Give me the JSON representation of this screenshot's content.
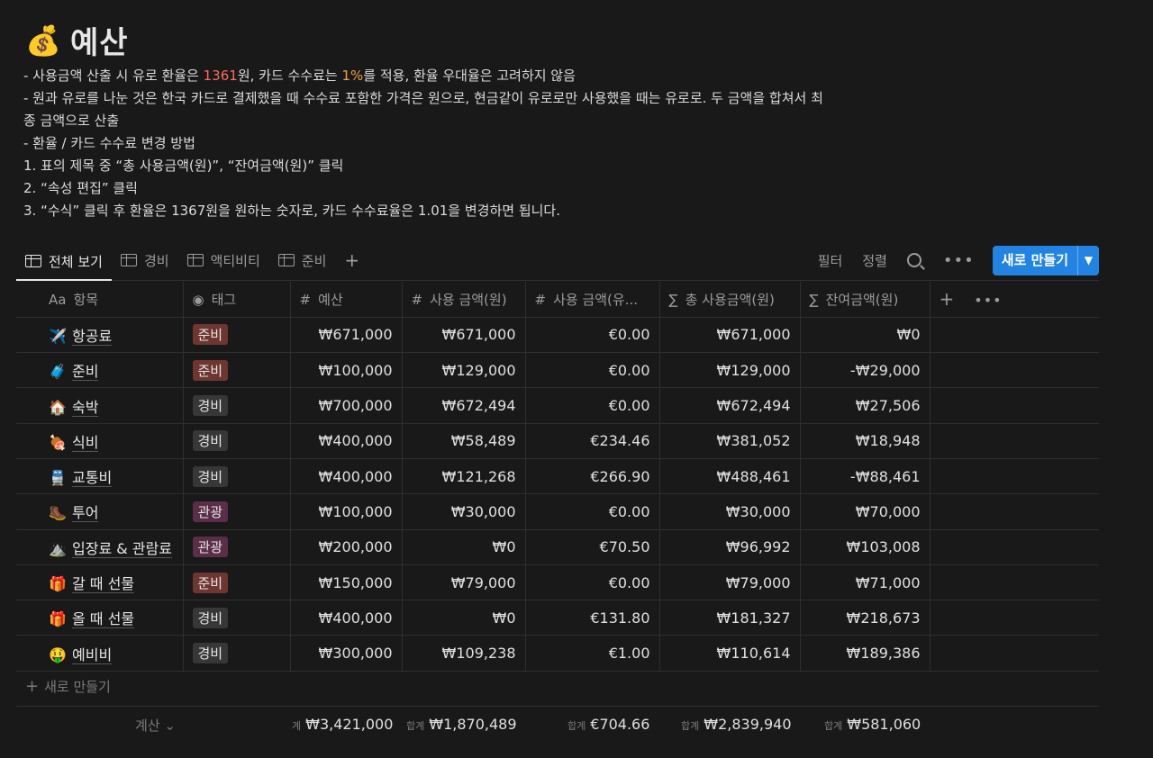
{
  "page": {
    "icon": "money-bag-icon",
    "title": "예산"
  },
  "description": {
    "line1_a": "- 사용금액 산출 시 유로 환율은 ",
    "line1_rate": "1361",
    "line1_b": "원, 카드 수수료는 ",
    "line1_fee": "1%",
    "line1_c": "를 적용, 환율 우대율은 고려하지 않음",
    "line2": "- 원과 유로를 나눈 것은 한국 카드로 결제했을 때 수수료 포함한 가격은 원으로, 현금같이 유로로만 사용했을 때는 유로로. 두 금액을 합쳐서 최",
    "line3": "종 금액으로 산출",
    "line4": "- 환율 / 카드 수수료 변경 방법",
    "line5": "1. 표의 제목 중 “총 사용금액(원)”, “잔여금액(원)” 클릭",
    "line6": "2. “속성 편집” 클릭",
    "line7": "3. “수식” 클릭 후 환율은 1367원을 원하는 숫자로, 카드 수수료율은 1.01을 변경하면 됩니다."
  },
  "tabs": [
    {
      "label": "전체 보기",
      "active": true
    },
    {
      "label": "경비"
    },
    {
      "label": "액티비티"
    },
    {
      "label": "준비"
    }
  ],
  "toolbar": {
    "filter": "필터",
    "sort": "정렬",
    "new_button": "새로 만들기"
  },
  "columns": {
    "name_icon": "Aa",
    "name": "항목",
    "tag": "태그",
    "budget": "예산",
    "used_krw": "사용 금액(원)",
    "used_eur": "사용 금액(유...",
    "total_used": "총 사용금액(원)",
    "remaining": "잔여금액(원)"
  },
  "tag_colors": {
    "준비": "#6e3630",
    "경비": "#373737",
    "관광": "#5a2e46"
  },
  "rows": [
    {
      "emoji": "✈️",
      "name": "항공료",
      "tag": "준비",
      "budget": "₩671,000",
      "used_krw": "₩671,000",
      "used_eur": "€0.00",
      "total": "₩671,000",
      "remaining": "₩0"
    },
    {
      "emoji": "🧳",
      "name": "준비",
      "tag": "준비",
      "budget": "₩100,000",
      "used_krw": "₩129,000",
      "used_eur": "€0.00",
      "total": "₩129,000",
      "remaining": "-₩29,000"
    },
    {
      "emoji": "🏠",
      "name": "숙박",
      "tag": "경비",
      "budget": "₩700,000",
      "used_krw": "₩672,494",
      "used_eur": "€0.00",
      "total": "₩672,494",
      "remaining": "₩27,506"
    },
    {
      "emoji": "🍖",
      "name": "식비",
      "tag": "경비",
      "budget": "₩400,000",
      "used_krw": "₩58,489",
      "used_eur": "€234.46",
      "total": "₩381,052",
      "remaining": "₩18,948"
    },
    {
      "emoji": "🚆",
      "name": "교통비",
      "tag": "경비",
      "budget": "₩400,000",
      "used_krw": "₩121,268",
      "used_eur": "€266.90",
      "total": "₩488,461",
      "remaining": "-₩88,461"
    },
    {
      "emoji": "🥾",
      "name": "투어",
      "tag": "관광",
      "budget": "₩100,000",
      "used_krw": "₩30,000",
      "used_eur": "€0.00",
      "total": "₩30,000",
      "remaining": "₩70,000"
    },
    {
      "emoji": "⛰️",
      "name": "입장료 & 관람료",
      "tag": "관광",
      "budget": "₩200,000",
      "used_krw": "₩0",
      "used_eur": "€70.50",
      "total": "₩96,992",
      "remaining": "₩103,008"
    },
    {
      "emoji": "🎁",
      "name": "갈 때 선물",
      "tag": "준비",
      "budget": "₩150,000",
      "used_krw": "₩79,000",
      "used_eur": "€0.00",
      "total": "₩79,000",
      "remaining": "₩71,000"
    },
    {
      "emoji": "🎁",
      "name": "올 때 선물",
      "tag": "경비",
      "budget": "₩400,000",
      "used_krw": "₩0",
      "used_eur": "€131.80",
      "total": "₩181,327",
      "remaining": "₩218,673"
    },
    {
      "emoji": "🤑",
      "name": "예비비",
      "tag": "경비",
      "budget": "₩300,000",
      "used_krw": "₩109,238",
      "used_eur": "€1.00",
      "total": "₩110,614",
      "remaining": "₩189,386"
    }
  ],
  "new_row_label": "새로 만들기",
  "footer": {
    "calc_toggle": "계산",
    "budget_label": "계",
    "budget_sum": "₩3,421,000",
    "used_krw_label": "합계",
    "used_krw_sum": "₩1,870,489",
    "used_eur_label": "합계",
    "used_eur_sum": "€704.66",
    "total_label": "합계",
    "total_sum": "₩2,839,940",
    "remaining_label": "합계",
    "remaining_sum": "₩581,060"
  }
}
